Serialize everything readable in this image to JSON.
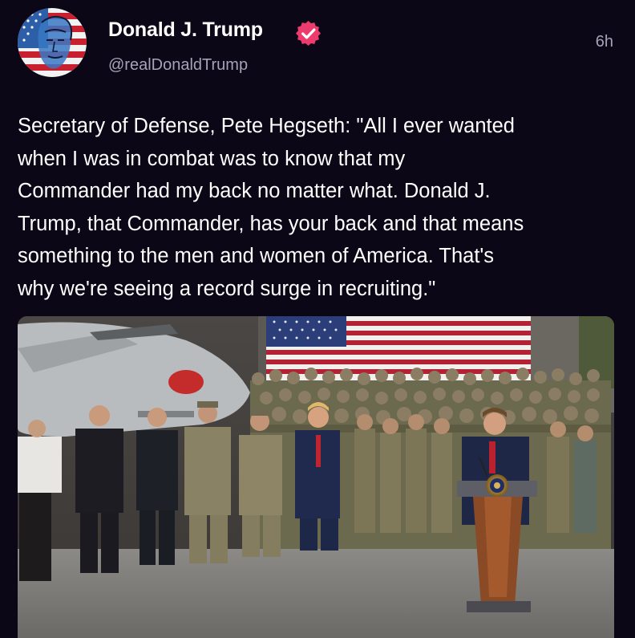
{
  "post": {
    "author": {
      "display_name": "Donald J. Trump",
      "handle": "@realDonaldTrump",
      "verified": true,
      "verified_icon": "verified-badge-icon",
      "avatar_icon": "avatar-flag-portrait"
    },
    "timestamp": "6h",
    "text_lines": [
      "Secretary of Defense, Pete Hegseth: \"All I ever wanted",
      "when I was in combat was to know that my",
      "Commander had my back no matter what. Donald J.",
      "Trump, that Commander, has your back and that means",
      "something to the men and women of America. That's",
      "why we're seeing a record surge in recruiting.\""
    ],
    "media": {
      "type": "video-thumbnail"
    }
  },
  "colors": {
    "background": "#0b0717",
    "text_primary": "#ffffff",
    "text_secondary": "#a7a2b8",
    "verified_badge": "#ec3b6c"
  }
}
